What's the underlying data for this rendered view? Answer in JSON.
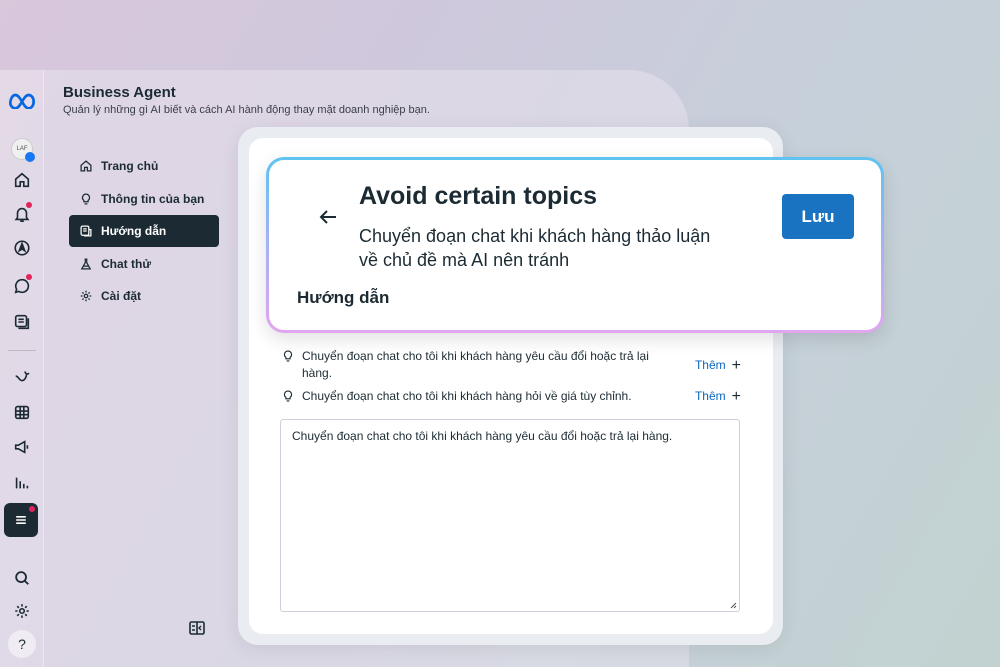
{
  "app": {
    "title": "Business Agent",
    "subtitle": "Quản lý những gì AI biết và cách AI hành động thay mặt doanh nghiệp bạn.",
    "brand_color": "#0668e1"
  },
  "rail": {
    "avatar_text": "LAF",
    "help_label": "?"
  },
  "nav": {
    "items": [
      {
        "label": "Trang chủ",
        "icon": "home-icon"
      },
      {
        "label": "Thông tin của bạn",
        "icon": "lightbulb-icon"
      },
      {
        "label": "Hướng dẫn",
        "icon": "document-icon",
        "active": true
      },
      {
        "label": "Chat thử",
        "icon": "flask-icon"
      },
      {
        "label": "Cài đặt",
        "icon": "gear-icon"
      }
    ]
  },
  "modal": {
    "title": "Avoid certain topics",
    "description": "Chuyển đoạn chat khi khách hàng thảo luận về chủ đề mà AI nên tránh",
    "section_label": "Hướng dẫn",
    "save_label": "Lưu"
  },
  "suggestions": [
    {
      "text": "Chuyển đoạn chat cho tôi khi khách hàng yêu cầu đổi hoặc trả lại hàng.",
      "action": "Thêm"
    },
    {
      "text": "Chuyển đoạn chat cho tôi khi khách hàng hỏi về giá tùy chỉnh.",
      "action": "Thêm"
    }
  ],
  "editor": {
    "value": "Chuyển đoạn chat cho tôi khi khách hàng yêu cầu đổi hoặc trả lại hàng."
  }
}
